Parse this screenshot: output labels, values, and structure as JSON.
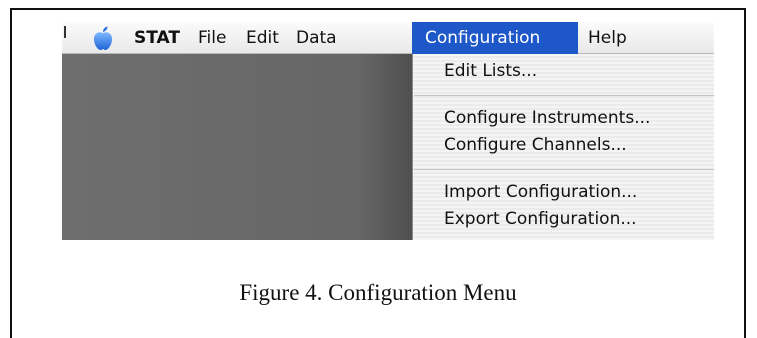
{
  "menubar": {
    "apple_icon": "apple-logo-icon",
    "items": [
      {
        "label": "STAT"
      },
      {
        "label": "File"
      },
      {
        "label": "Edit"
      },
      {
        "label": "Data"
      },
      {
        "label": "Configuration"
      },
      {
        "label": "Help"
      }
    ],
    "active_item": "Configuration",
    "active_color": "#1d57c8"
  },
  "dropdown": {
    "items": [
      {
        "label": "Edit Lists..."
      },
      {
        "label": "Configure Instruments..."
      },
      {
        "label": "Configure Channels..."
      },
      {
        "label": "Import Configuration..."
      },
      {
        "label": "Export Configuration..."
      }
    ]
  },
  "caption": "Figure 4.  Configuration Menu"
}
